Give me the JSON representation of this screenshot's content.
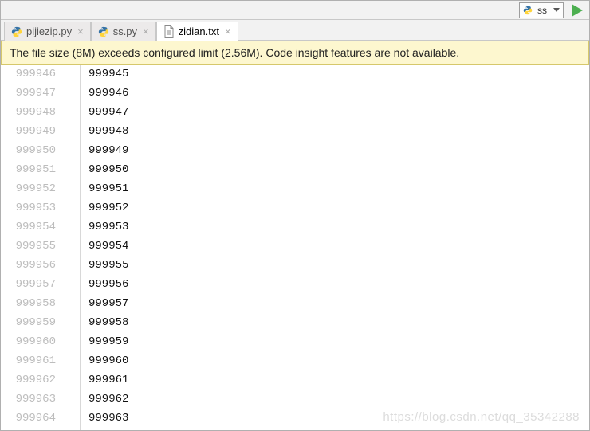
{
  "toolbar": {
    "run_config_label": "ss"
  },
  "tabs": [
    {
      "label": "pijiezip.py",
      "type": "py",
      "active": false
    },
    {
      "label": "ss.py",
      "type": "py",
      "active": false
    },
    {
      "label": "zidian.txt",
      "type": "txt",
      "active": true
    }
  ],
  "banner": {
    "message": "The file size (8M) exceeds configured limit (2.56M). Code insight features are not available."
  },
  "editor": {
    "lines": [
      {
        "num": "999946",
        "text": "999945"
      },
      {
        "num": "999947",
        "text": "999946"
      },
      {
        "num": "999948",
        "text": "999947"
      },
      {
        "num": "999949",
        "text": "999948"
      },
      {
        "num": "999950",
        "text": "999949"
      },
      {
        "num": "999951",
        "text": "999950"
      },
      {
        "num": "999952",
        "text": "999951"
      },
      {
        "num": "999953",
        "text": "999952"
      },
      {
        "num": "999954",
        "text": "999953"
      },
      {
        "num": "999955",
        "text": "999954"
      },
      {
        "num": "999956",
        "text": "999955"
      },
      {
        "num": "999957",
        "text": "999956"
      },
      {
        "num": "999958",
        "text": "999957"
      },
      {
        "num": "999959",
        "text": "999958"
      },
      {
        "num": "999960",
        "text": "999959"
      },
      {
        "num": "999961",
        "text": "999960"
      },
      {
        "num": "999962",
        "text": "999961"
      },
      {
        "num": "999963",
        "text": "999962"
      },
      {
        "num": "999964",
        "text": "999963"
      }
    ]
  },
  "watermark": "https://blog.csdn.net/qq_35342288"
}
